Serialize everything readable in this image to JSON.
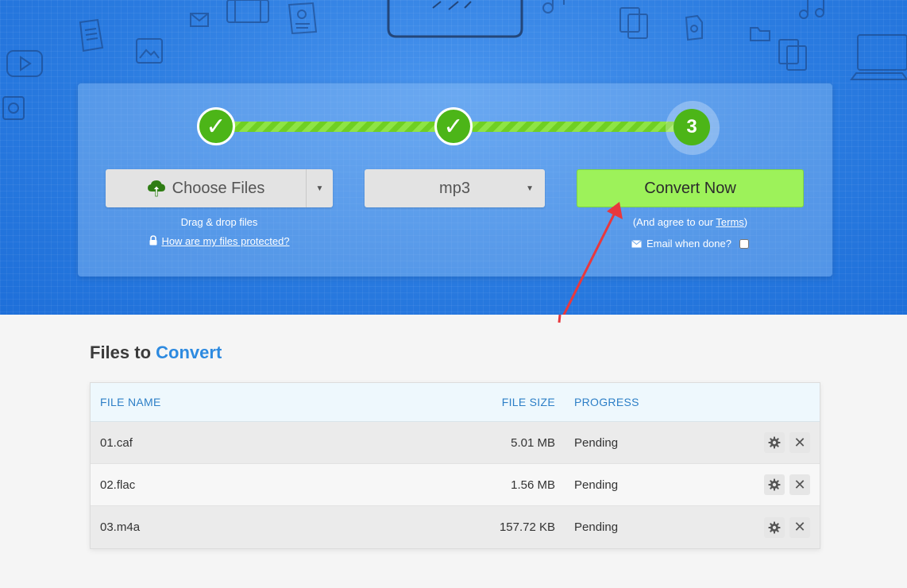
{
  "stepper": {
    "step1_mark": "✓",
    "step2_mark": "✓",
    "step3_label": "3"
  },
  "upload": {
    "choose_label": "Choose Files",
    "drag_text": "Drag & drop files",
    "protect_text": "How are my files protected?"
  },
  "format": {
    "selected": "mp3"
  },
  "convert": {
    "button_label": "Convert Now",
    "agree_prefix": "(And agree to our ",
    "terms_label": "Terms",
    "agree_suffix": ")",
    "email_label": "Email when done?"
  },
  "files": {
    "title_prefix": "Files to",
    "title_accent": "Convert",
    "headers": {
      "name": "FILE NAME",
      "size": "FILE SIZE",
      "progress": "PROGRESS"
    },
    "rows": [
      {
        "name": "01.caf",
        "size": "5.01 MB",
        "progress": "Pending"
      },
      {
        "name": "02.flac",
        "size": "1.56 MB",
        "progress": "Pending"
      },
      {
        "name": "03.m4a",
        "size": "157.72 KB",
        "progress": "Pending"
      }
    ]
  },
  "colors": {
    "hero_bg": "#2a7be0",
    "step_green": "#4cb518",
    "convert_green": "#9df25a",
    "accent_blue": "#2d8ae0",
    "annotation_red": "#e8383d"
  }
}
